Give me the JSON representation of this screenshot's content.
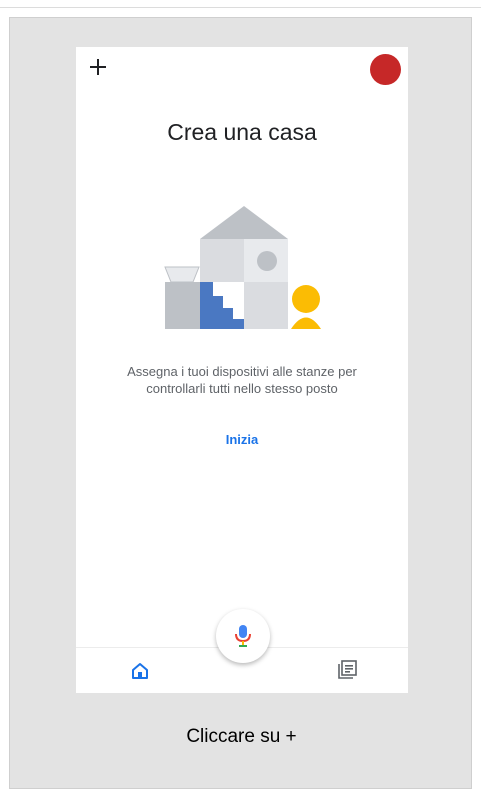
{
  "screen": {
    "title": "Crea una casa",
    "description_line1": "Assegna i tuoi dispositivi alle stanze per",
    "description_line2": "controllarli tutti nello stesso posto",
    "start_label": "Inizia"
  },
  "top_bar": {
    "add_icon": "plus-icon",
    "avatar_color": "#c62828"
  },
  "bottom_nav": {
    "home_icon": "home-icon",
    "feed_icon": "feed-icon",
    "mic_icon": "microphone-icon",
    "active_color": "#1a73e8"
  },
  "caption": "Cliccare su +",
  "colors": {
    "accent": "#1a73e8",
    "illustration_gray": "#bdc1c6",
    "illustration_light": "#dadce0",
    "illustration_blue": "#4a78c2",
    "illustration_yellow": "#fbbc04",
    "background_card": "#e3e3e3"
  }
}
